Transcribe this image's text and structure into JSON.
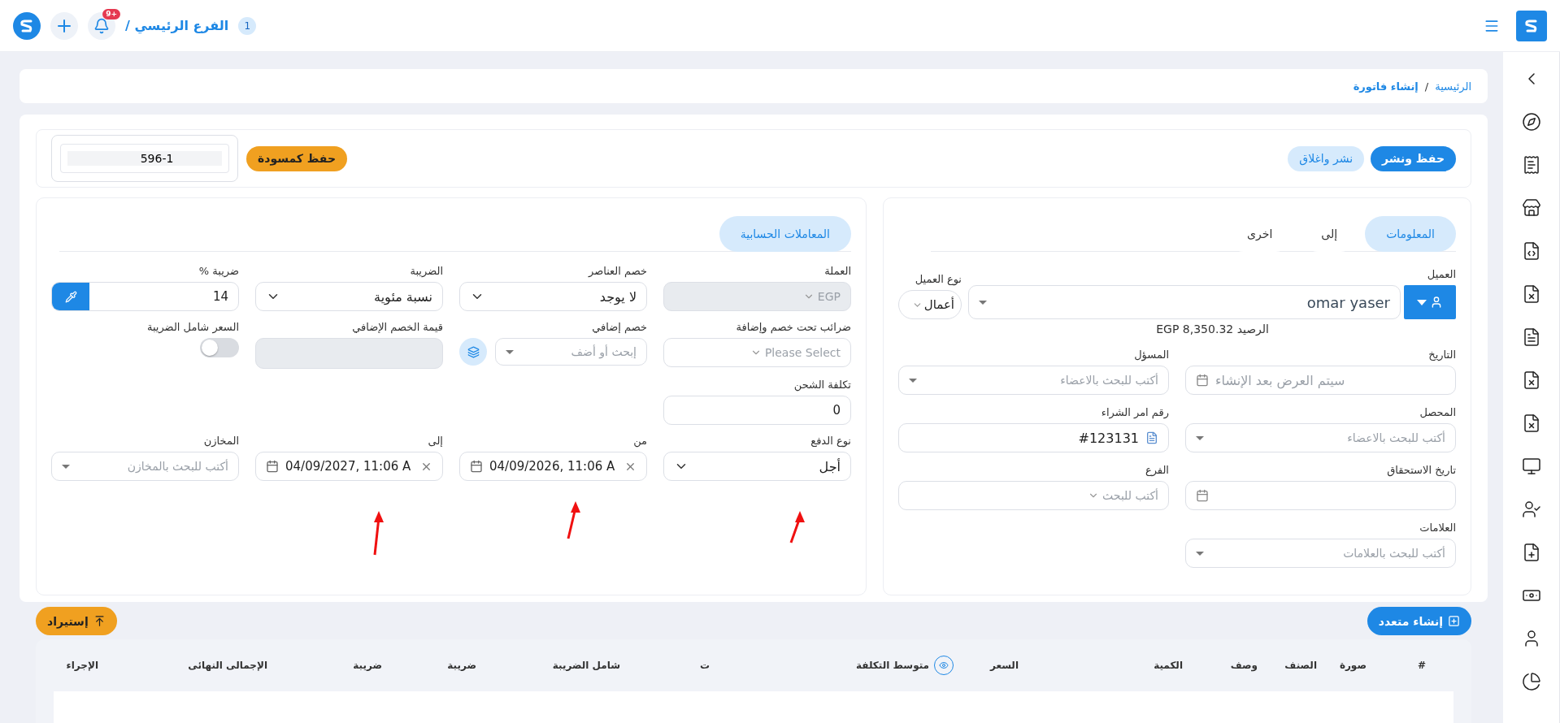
{
  "topbar": {
    "branch_badge": "1",
    "branch_label": "الفرع الرئيسي /",
    "notification_count": "+9"
  },
  "breadcrumb": {
    "items": [
      "الرئيسية",
      "إنشاء فاتورة"
    ],
    "separator": "/"
  },
  "toolbar": {
    "buttons": [
      {
        "label": "حفظ ونشر",
        "kind": "primary"
      },
      {
        "label": "نشر واغلاق",
        "kind": "secondary"
      }
    ],
    "draft_button": "حفظ كمسودة",
    "invoice_number": "596-1"
  },
  "info_panel": {
    "tabs": [
      {
        "label": "المعلومات",
        "selected": true
      },
      {
        "label": "إلى",
        "selected": false
      },
      {
        "label": "اخرى",
        "selected": false
      }
    ],
    "customer": {
      "label": "العميل",
      "value": "omar yaser"
    },
    "customer_type": {
      "label": "نوع العميل",
      "value": "أعمال"
    },
    "balance": "الرصيد EGP 8,350.32",
    "fields": [
      {
        "label": "التاريخ",
        "kind": "date",
        "placeholder": "سيتم العرض بعد الإنشاء"
      },
      {
        "label": "المسؤل",
        "kind": "search",
        "placeholder": "أكتب للبحث بالاعضاء"
      },
      {
        "label": "المحصل",
        "kind": "search",
        "placeholder": "أكتب للبحث بالاعضاء"
      },
      {
        "label": "رقم امر الشراء",
        "kind": "doc",
        "value": "#123131"
      },
      {
        "label": "تاريخ الاستحقاق",
        "kind": "date"
      },
      {
        "label": "الفرع",
        "kind": "combo",
        "placeholder": "أكتب للبحث"
      },
      {
        "label": "العلامات",
        "kind": "search",
        "placeholder": "أكتب للبحث بالعلامات"
      }
    ]
  },
  "accounting_panel": {
    "tab": {
      "label": "المعاملات الحسابية",
      "selected": true
    },
    "rows": [
      [
        {
          "label": "العملة",
          "kind": "combo",
          "value": "EGP",
          "disabled": true
        },
        {
          "label": "خصم العناصر",
          "kind": "dropdown",
          "value": "لا يوجد",
          "disabled": false
        },
        {
          "label": "الضريبة",
          "kind": "dropdown",
          "value": "نسبة مئوية",
          "disabled": false
        },
        {
          "label": "ضريبة %",
          "kind": "rate",
          "value": "14",
          "disabled": false
        }
      ],
      [
        {
          "label": "ضرائب تحت خصم وإضافة",
          "kind": "combo",
          "placeholder": "Please Select",
          "disabled": false
        },
        {
          "label": "خصم إضافي",
          "kind": "discount",
          "placeholder": "إبحث أو أضف",
          "disabled": false
        },
        {
          "label": "قيمة الخصم الإضافي",
          "kind": "blank",
          "disabled": true
        },
        {
          "label": "السعر شامل الضريبة",
          "kind": "toggle",
          "on": false,
          "disabled": false
        }
      ],
      [
        {
          "label": "تكلفة الشحن",
          "kind": "text",
          "value": "0",
          "disabled": false
        }
      ],
      [
        {
          "label": "نوع الدفع",
          "kind": "dropdown",
          "value": "أجل",
          "disabled": false
        },
        {
          "label": "من",
          "kind": "datetime",
          "value": "04/09/2026, 11:06 A",
          "disabled": false
        },
        {
          "label": "إلى",
          "kind": "datetime",
          "value": "04/09/2027, 11:06 A",
          "disabled": false
        },
        {
          "label": "المخازن",
          "kind": "search",
          "placeholder": "أكتب للبحث بالمخازن",
          "disabled": false
        }
      ]
    ]
  },
  "actions": {
    "create_multiple": "إنشاء متعدد",
    "import": "إستيراد"
  },
  "table": {
    "columns": [
      {
        "label": "#",
        "kind": "plain"
      },
      {
        "label": "صورة",
        "kind": "plain"
      },
      {
        "label": "الصنف",
        "kind": "plain"
      },
      {
        "label": "وصف",
        "kind": "plain"
      },
      {
        "label": "الكمية",
        "kind": "plain"
      },
      {
        "label": "السعر",
        "kind": "plain"
      },
      {
        "label": "متوسط التكلفة",
        "kind": "visibility"
      },
      {
        "label": "ت",
        "kind": "plain"
      },
      {
        "label": "شامل الضريبة",
        "kind": "plain"
      },
      {
        "label": "ضريبة",
        "kind": "plain"
      },
      {
        "label": "ضريبة",
        "kind": "plain"
      },
      {
        "label": "الإجمالى النهائى",
        "kind": "plain"
      },
      {
        "label": "الإجراء",
        "kind": "plain"
      }
    ]
  }
}
